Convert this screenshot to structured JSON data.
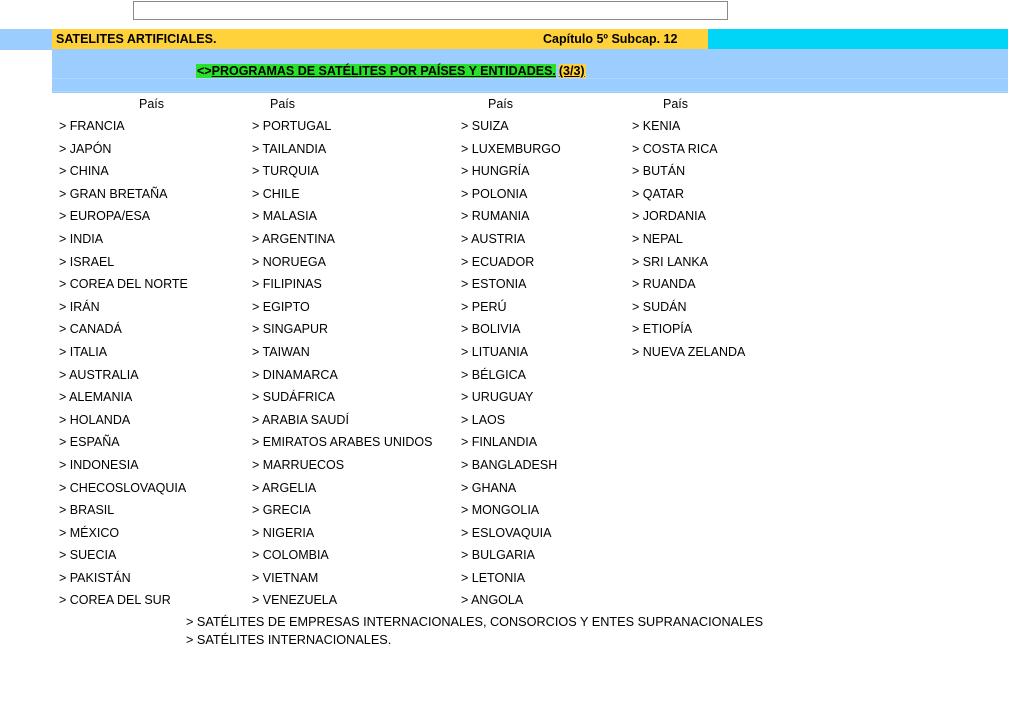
{
  "document": {
    "top_box_text": ""
  },
  "banner": {
    "title": "SATELITES ARTIFICIALES.",
    "chapter": "Capítulo 5º Subcap. 12",
    "subtitle_marker": "<>",
    "subtitle": "PROGRAMAS DE SATÉLITES POR PAÍSES Y ENTIDADES.",
    "subtitle_count": "(3/3)",
    "colors": {
      "gold": "#ffd23b",
      "cyan": "#00d5f7",
      "light_blue": "#9bcdff",
      "green_highlight": "#2ae02a"
    }
  },
  "table": {
    "headers": [
      "País",
      "País",
      "País",
      "País"
    ],
    "columns": [
      {
        "header": "País",
        "items": [
          "> FRANCIA",
          "> JAPÓN",
          "> CHINA",
          "> GRAN BRETAÑA",
          "> EUROPA/ESA",
          "> INDIA",
          "> ISRAEL",
          "> COREA DEL NORTE",
          "> IRÁN",
          "> CANADÁ",
          "> ITALIA",
          "> AUSTRALIA",
          "> ALEMANIA",
          "> HOLANDA",
          "> ESPAÑA",
          "> INDONESIA",
          "> CHECOSLOVAQUIA",
          "> BRASIL",
          "> MÉXICO",
          "> SUECIA",
          "> PAKISTÁN",
          "> COREA DEL SUR"
        ]
      },
      {
        "header": "País",
        "items": [
          "> PORTUGAL",
          "> TAILANDIA",
          "> TURQUIA",
          "> CHILE",
          "> MALASIA",
          "> ARGENTINA",
          "> NORUEGA",
          "> FILIPINAS",
          "> EGIPTO",
          "> SINGAPUR",
          "> TAIWAN",
          "> DINAMARCA",
          "> SUDÁFRICA",
          "> ARABIA SAUDÍ",
          "> EMIRATOS ARABES UNIDOS",
          "> MARRUECOS",
          "> ARGELIA",
          "> GRECIA",
          "> NIGERIA",
          "> COLOMBIA",
          "> VIETNAM",
          "> VENEZUELA"
        ]
      },
      {
        "header": "País",
        "items": [
          "> SUIZA",
          "> LUXEMBURGO",
          "> HUNGRÍA",
          "> POLONIA",
          "> RUMANIA",
          "> AUSTRIA",
          "> ECUADOR",
          "> ESTONIA",
          "> PERÚ",
          "> BOLIVIA",
          "> LITUANIA",
          "> BÉLGICA",
          "> URUGUAY",
          "> LAOS",
          "> FINLANDIA",
          "> BANGLADESH",
          "> GHANA",
          "> MONGOLIA",
          "> ESLOVAQUIA",
          "> BULGARIA",
          "> LETONIA",
          "> ANGOLA"
        ]
      },
      {
        "header": "País",
        "items": [
          "> KENIA",
          "> COSTA RICA",
          "> BUTÁN",
          "> QATAR",
          "> JORDANIA",
          "> NEPAL",
          "> SRI LANKA",
          "> RUANDA",
          "> SUDÁN",
          "> ETIOPÍA",
          "> NUEVA ZELANDA"
        ]
      }
    ]
  },
  "footer": {
    "lines": [
      "> SATÉLITES DE EMPRESAS INTERNACIONALES, CONSORCIOS Y ENTES SUPRANACIONALES",
      "> SATÉLITES INTERNACIONALES."
    ]
  }
}
